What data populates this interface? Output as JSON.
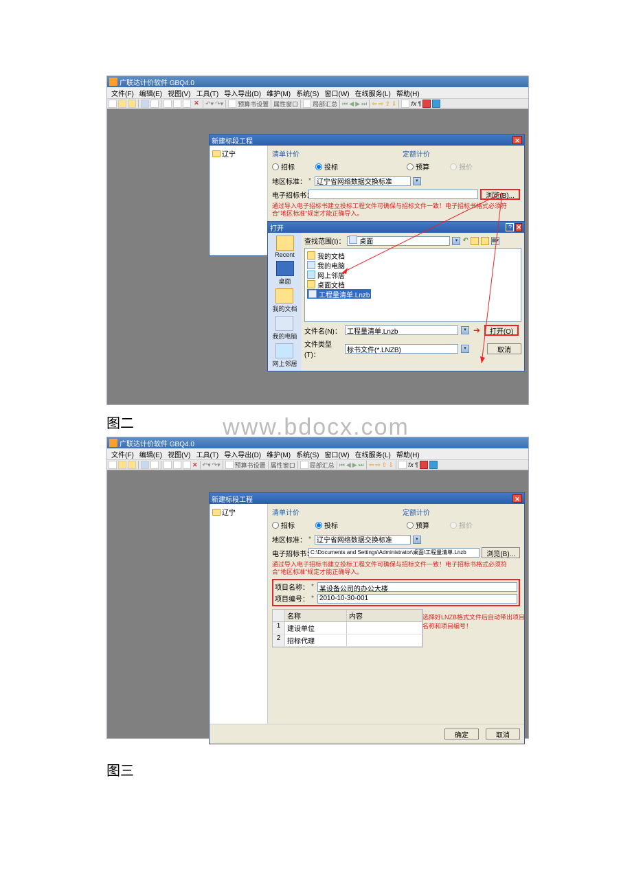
{
  "watermark": "www.bdocx.com",
  "captions": {
    "fig2": "图二",
    "fig3": "图三"
  },
  "app": {
    "title": "广联达计价软件 GBQ4.0",
    "menus": [
      "文件(F)",
      "编辑(E)",
      "视图(V)",
      "工具(T)",
      "导入导出(D)",
      "维护(M)",
      "系统(S)",
      "窗口(W)",
      "在线服务(L)",
      "帮助(H)"
    ],
    "toolbar_labels": {
      "preset": "预算书设置",
      "propwin": "属性窗口",
      "summary": "局部汇总"
    }
  },
  "newproj": {
    "title": "新建标段工程",
    "tree": "辽宁",
    "tab1": "清单计价",
    "tab2": "定额计价",
    "radios": {
      "zhaobiao": "招标",
      "toubiao": "投标",
      "yusuan": "预算",
      "baojia": "报价"
    },
    "region_label": "地区标准：",
    "region_value": "辽宁省网络数据交换标准",
    "ebook_label": "电子招标书：",
    "browse": "浏览(B)...",
    "warn": "通过导入电子招标书建立投标工程文件可确保与招标文件一致！电子招标书格式必须符合\"地区标准\"规定才能正确导入。",
    "projname_label": "项目名称：",
    "projname_value": "某设备公司的办公大楼",
    "projno_label": "项目编号：",
    "projno_value": "2010-10-30-001",
    "ebook_path": "C:\\Documents and Settings\\Administrator\\桌面\\工程量清单.Lnzb",
    "ok": "确定",
    "cancel": "取消",
    "grid": {
      "h1": "名称",
      "h2": "内容",
      "r1": "建设单位",
      "r2": "招标代理"
    },
    "note": "选择好LNZB格式文件后自动带出项目名称和项目编号！"
  },
  "open": {
    "title": "打开",
    "lookin_label": "查找范围(I)：",
    "lookin_value": "桌面",
    "sidebar": {
      "recent": "Recent",
      "desktop": "桌面",
      "mydoc": "我的文档",
      "mypc": "我的电脑",
      "net": "网上邻居"
    },
    "files": {
      "mydoc": "我的文档",
      "mypc": "我的电脑",
      "net": "网上邻居",
      "deskdoc": "桌面文档",
      "sel": "工程量清单.Lnzb"
    },
    "filename_label": "文件名(N)：",
    "filename_value": "工程量清单.Lnzb",
    "filetype_label": "文件类型(T)：",
    "filetype_value": "标书文件(*.LNZB)",
    "open_btn": "打开(O)",
    "cancel_btn": "取消"
  }
}
